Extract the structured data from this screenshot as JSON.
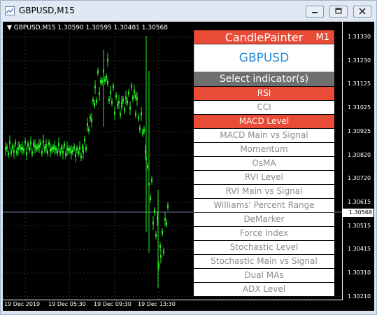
{
  "window": {
    "title": "GBPUSD,M15"
  },
  "window_buttons": {
    "minimize": "minimize",
    "maximize": "maximize",
    "close": "close"
  },
  "chart": {
    "header": "▼ GBPUSD,M15   1.30590 1.30595 1.30481 1.30568",
    "current_price": "1.30568",
    "y_labels": [
      "1.31330",
      "1.31230",
      "1.31125",
      "1.31025",
      "1.30925",
      "1.30820",
      "1.30720",
      "1.30615",
      "1.30515",
      "1.30415",
      "1.30310",
      "1.30210"
    ],
    "x_labels": [
      "19 Dec 2019",
      "19 Dec 05:30",
      "19 Dec 09:30",
      "19 Dec 13:30"
    ],
    "colors": {
      "candles": "#22ee22",
      "background": "#000000"
    }
  },
  "panel": {
    "title": "CandlePainter",
    "timeframe": "M1",
    "symbol": "GBPUSD",
    "select_label": "Select indicator(s)",
    "indicators": [
      {
        "label": "RSI",
        "active": true
      },
      {
        "label": "CCI",
        "active": false
      },
      {
        "label": "MACD Level",
        "active": true
      },
      {
        "label": "MACD Main vs Signal",
        "active": false
      },
      {
        "label": "Momentum",
        "active": false
      },
      {
        "label": "OsMA",
        "active": false
      },
      {
        "label": "RVI Level",
        "active": false
      },
      {
        "label": "RVI Main vs Signal",
        "active": false
      },
      {
        "label": "Williams' Percent Range",
        "active": false
      },
      {
        "label": "DeMarker",
        "active": false
      },
      {
        "label": "Force Index",
        "active": false
      },
      {
        "label": "Stochastic Level",
        "active": false
      },
      {
        "label": "Stochastic Main vs Signal",
        "active": false
      },
      {
        "label": "Dual MAs",
        "active": false
      },
      {
        "label": "ADX Level",
        "active": false
      }
    ],
    "colors": {
      "accent": "#e84c37",
      "symbol": "#2a8bd8",
      "select_bg": "#6f6f6f"
    }
  }
}
